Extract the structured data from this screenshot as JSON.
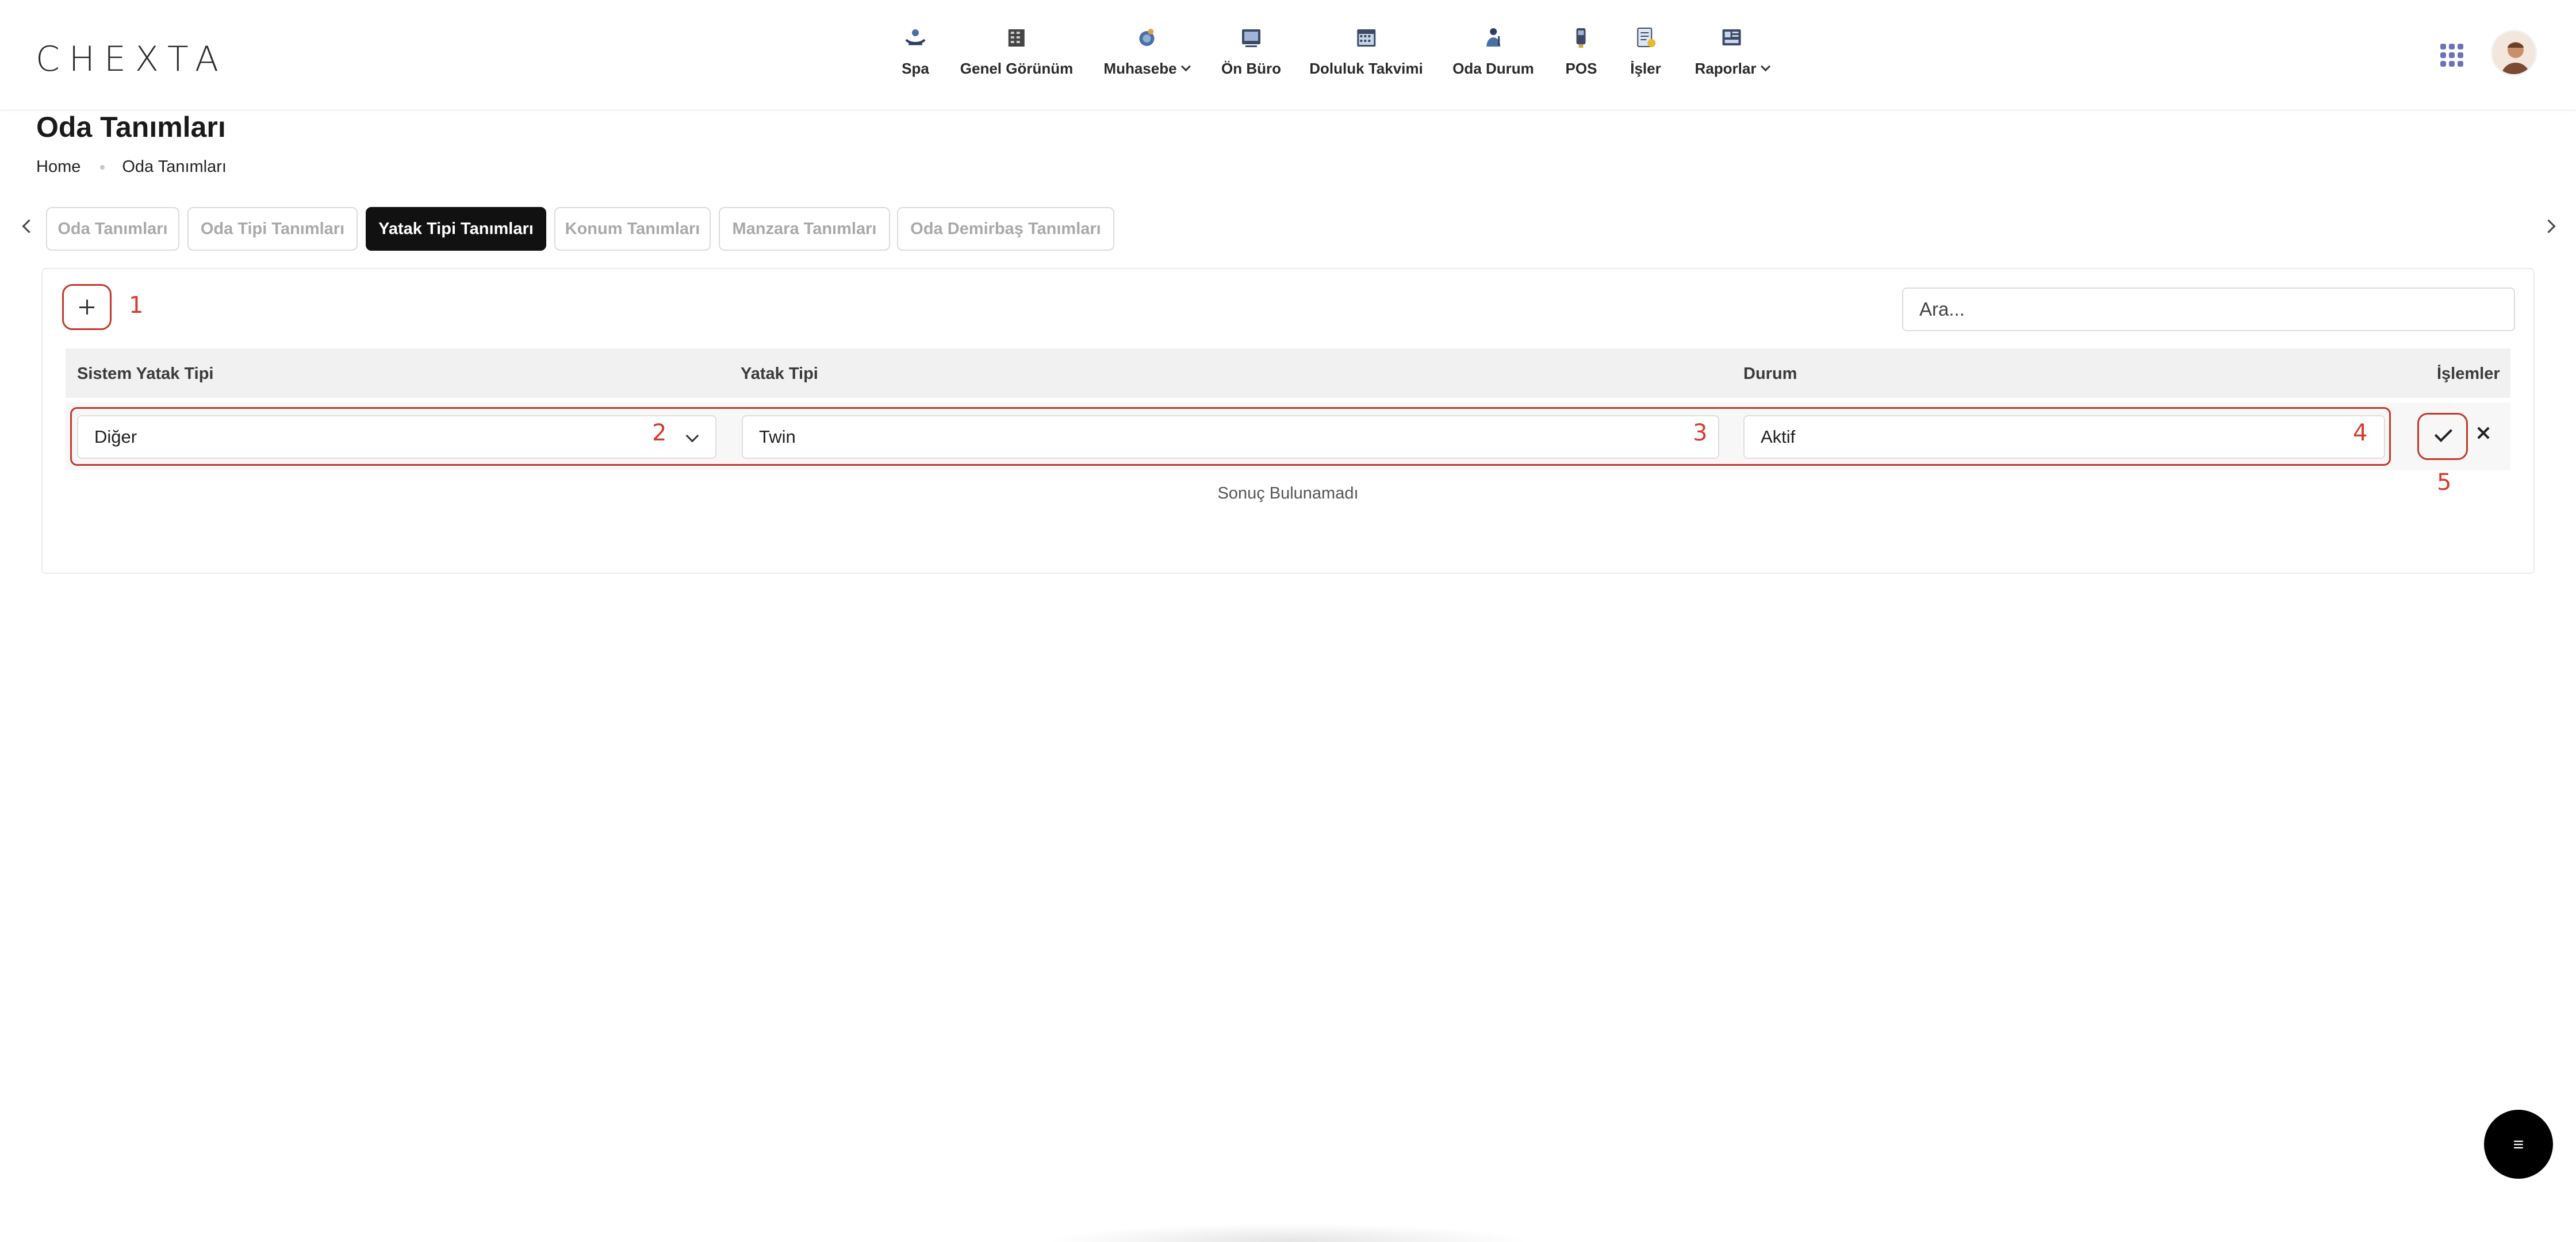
{
  "app": {
    "logo": "CHEXTA"
  },
  "nav": {
    "items": [
      {
        "label": "Spa",
        "icon": "spa-icon",
        "has_dropdown": false
      },
      {
        "label": "Genel Görünüm",
        "icon": "building-icon",
        "has_dropdown": false
      },
      {
        "label": "Muhasebe",
        "icon": "accounting-icon",
        "has_dropdown": true
      },
      {
        "label": "Ön Büro",
        "icon": "front-desk-icon",
        "has_dropdown": false
      },
      {
        "label": "Doluluk Takvimi",
        "icon": "calendar-icon",
        "has_dropdown": false
      },
      {
        "label": "Oda Durum",
        "icon": "housekeeping-icon",
        "has_dropdown": false
      },
      {
        "label": "POS",
        "icon": "pos-icon",
        "has_dropdown": false
      },
      {
        "label": "İşler",
        "icon": "tasks-icon",
        "has_dropdown": false
      },
      {
        "label": "Raporlar",
        "icon": "reports-icon",
        "has_dropdown": true
      }
    ]
  },
  "page": {
    "title": "Oda Tanımları",
    "breadcrumb": [
      "Home",
      "Oda Tanımları"
    ]
  },
  "tabs": [
    {
      "label": "Oda Tanımları",
      "active": false
    },
    {
      "label": "Oda Tipi Tanımları",
      "active": false
    },
    {
      "label": "Yatak Tipi Tanımları",
      "active": true
    },
    {
      "label": "Konum Tanımları",
      "active": false
    },
    {
      "label": "Manzara Tanımları",
      "active": false
    },
    {
      "label": "Oda Demirbaş Tanımları",
      "active": false
    }
  ],
  "toolbar": {
    "search_placeholder": "Ara..."
  },
  "table": {
    "columns": [
      "Sistem Yatak Tipi",
      "Yatak Tipi",
      "Durum",
      "İşlemler"
    ],
    "edit_row": {
      "system_bed_type": "Diğer",
      "bed_type": "Twin",
      "status": "Aktif"
    },
    "empty_message": "Sonuç Bulunamadı"
  },
  "annotations": [
    "1",
    "2",
    "3",
    "4",
    "5"
  ],
  "fab": {
    "label": "≡"
  },
  "colors": {
    "accent": "#111111",
    "annotation": "#c0392b",
    "header_bg": "#f1f1f1"
  }
}
